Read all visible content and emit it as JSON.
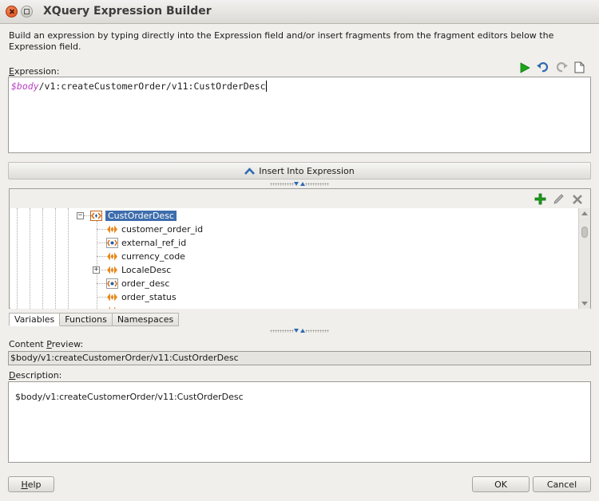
{
  "window": {
    "title": "XQuery Expression Builder"
  },
  "intro_text": "Build an expression by typing directly into the Expression field and/or insert fragments from the fragment editors below the Expression field.",
  "expression": {
    "label": "Expression:",
    "variable": "$body",
    "path": "/v1:createCustomerOrder/v11:CustOrderDesc",
    "toolbar": [
      "run-icon",
      "undo-icon",
      "redo-icon",
      "new-document-icon"
    ]
  },
  "insert_button": {
    "label": "Insert Into Expression"
  },
  "tree": {
    "toolbar": [
      "add-icon",
      "edit-icon",
      "delete-icon"
    ],
    "root": {
      "label": "CustOrderDesc",
      "icon": "element-icon",
      "expanded": true,
      "selected": true
    },
    "children": [
      {
        "label": "customer_order_id",
        "icon": "element-icon"
      },
      {
        "label": "external_ref_id",
        "icon": "attribute-icon"
      },
      {
        "label": "currency_code",
        "icon": "element-icon"
      },
      {
        "label": "LocaleDesc",
        "icon": "element-icon",
        "expandable": true
      },
      {
        "label": "order_desc",
        "icon": "attribute-icon"
      },
      {
        "label": "order_status",
        "icon": "element-icon"
      }
    ]
  },
  "tabs": [
    "Variables",
    "Functions",
    "Namespaces"
  ],
  "active_tab": "Variables",
  "content_preview": {
    "label": "Content Preview:",
    "value": "$body/v1:createCustomerOrder/v11:CustOrderDesc"
  },
  "description": {
    "label": "Description:",
    "value": "$body/v1:createCustomerOrder/v11:CustOrderDesc"
  },
  "buttons": {
    "help": "Help",
    "ok": "OK",
    "cancel": "Cancel"
  },
  "colors": {
    "selection": "#3d6dac",
    "variable_text": "#b83fc1",
    "run_green": "#1aa51a",
    "node_orange": "#e8891c"
  }
}
